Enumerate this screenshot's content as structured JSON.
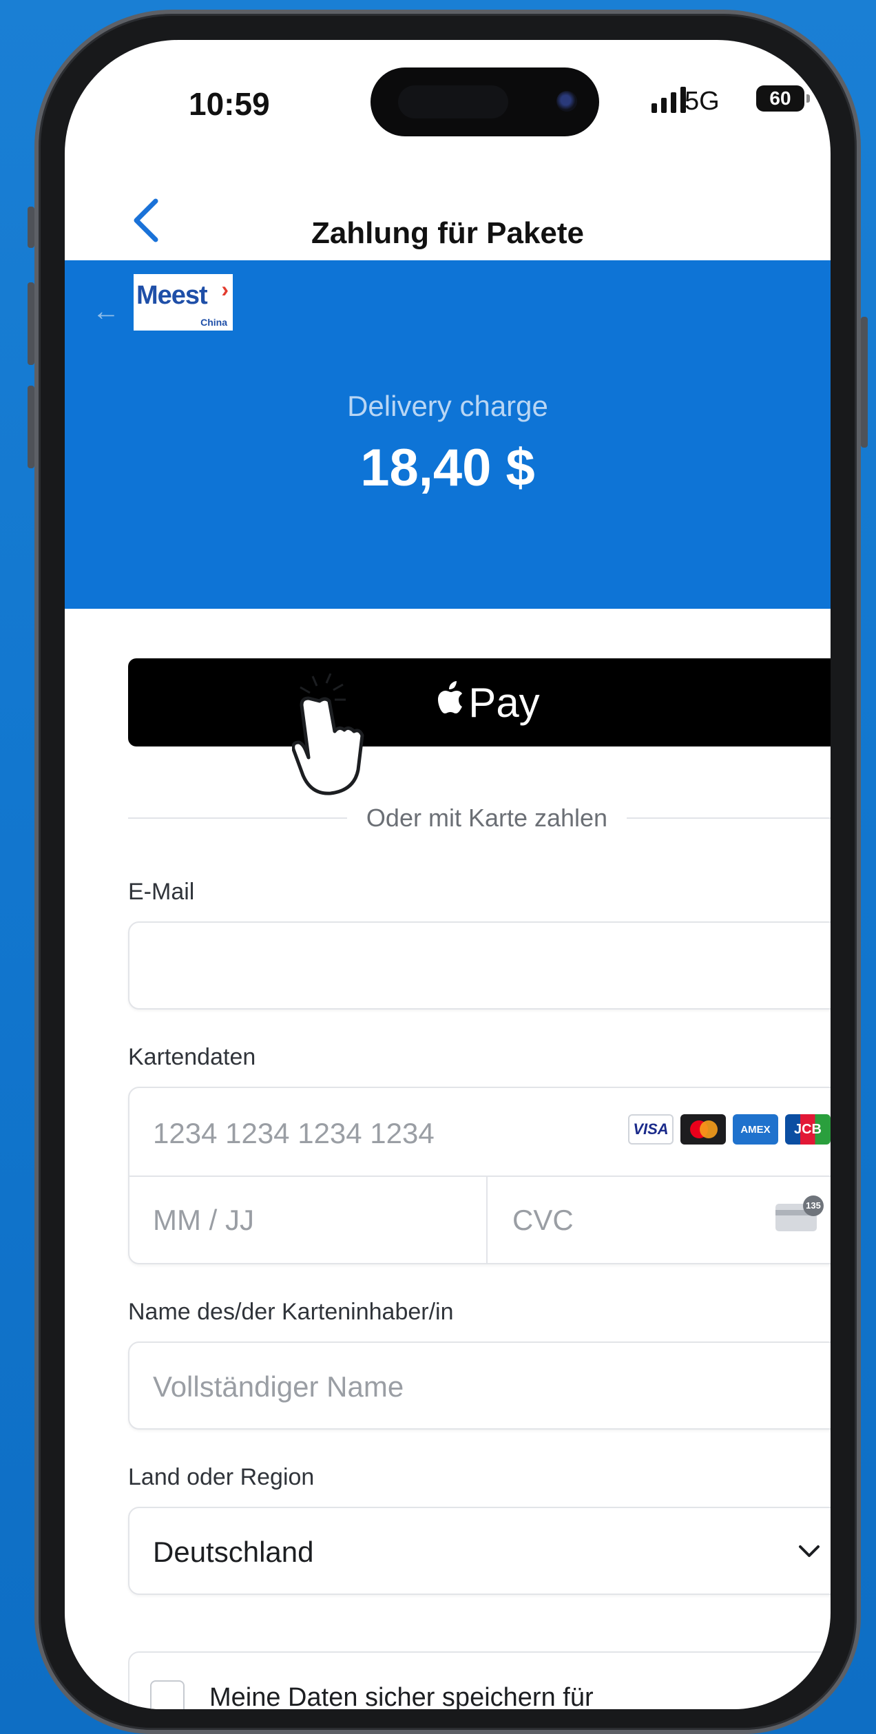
{
  "status_bar": {
    "time": "10:59",
    "network": "5G",
    "battery": "60"
  },
  "header": {
    "title": "Zahlung für Pakete",
    "back_icon": "chevron-left-icon"
  },
  "banner": {
    "logo_text": "Meest",
    "logo_sub": "China",
    "charge_label": "Delivery charge",
    "charge_amount": "18,40 $"
  },
  "apple_pay": {
    "label": "Pay"
  },
  "divider_text": "Oder mit Karte zahlen",
  "form": {
    "email_label": "E-Mail",
    "email_value": "",
    "card_label": "Kartendaten",
    "card_number_placeholder": "1234 1234 1234 1234",
    "expiry_placeholder": "MM / JJ",
    "cvc_placeholder": "CVC",
    "cvc_icon_number": "135",
    "card_brands": [
      "VISA",
      "Mastercard",
      "AMEX",
      "JCB"
    ],
    "visa_text": "VISA",
    "amex_text": "AMEX",
    "jcb_text": "JCB",
    "name_label": "Name des/der Karteninhaber/in",
    "name_placeholder": "Vollständiger Name",
    "country_label": "Land oder Region",
    "country_value": "Deutschland",
    "save_text": "Meine Daten sicher speichern für Zahlungsvorgänge mit einem Klick"
  },
  "colors": {
    "banner_blue": "#0e74d6",
    "accent_blue": "#1a72d8",
    "background": "#1277cf"
  }
}
